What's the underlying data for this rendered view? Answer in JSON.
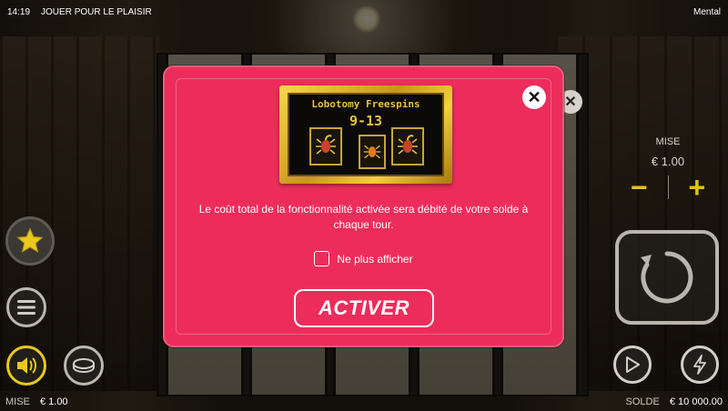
{
  "topbar": {
    "time": "14:19",
    "mode": "JOUER POUR LE PLAISIR",
    "game_name": "Mental"
  },
  "bet_panel": {
    "label": "MISE",
    "value": "€ 1.00",
    "minus": "−",
    "plus": "+"
  },
  "bottombar": {
    "bet_label": "MISE",
    "bet_value": "€ 1.00",
    "balance_label": "SOLDE",
    "balance_value": "€ 10 000.00"
  },
  "modal": {
    "ticket_title": "Lobotomy Freespins",
    "ticket_range": "9-13",
    "message": "Le coût total de la fonctionnalité activée sera débité de votre solde à chaque tour.",
    "checkbox_label": "Ne plus afficher",
    "activate_label": "ACTIVER",
    "close_symbol": "✕"
  },
  "colors": {
    "modal_bg": "#ec2d5b",
    "accent_yellow": "#e0c21c",
    "ticket_gold": "#f3cf3c"
  },
  "icons": [
    "star-icon",
    "menu-icon",
    "speaker-icon",
    "coin-icon",
    "spin-icon",
    "play-icon",
    "lightning-icon",
    "scorpion-icon",
    "close-icon"
  ]
}
